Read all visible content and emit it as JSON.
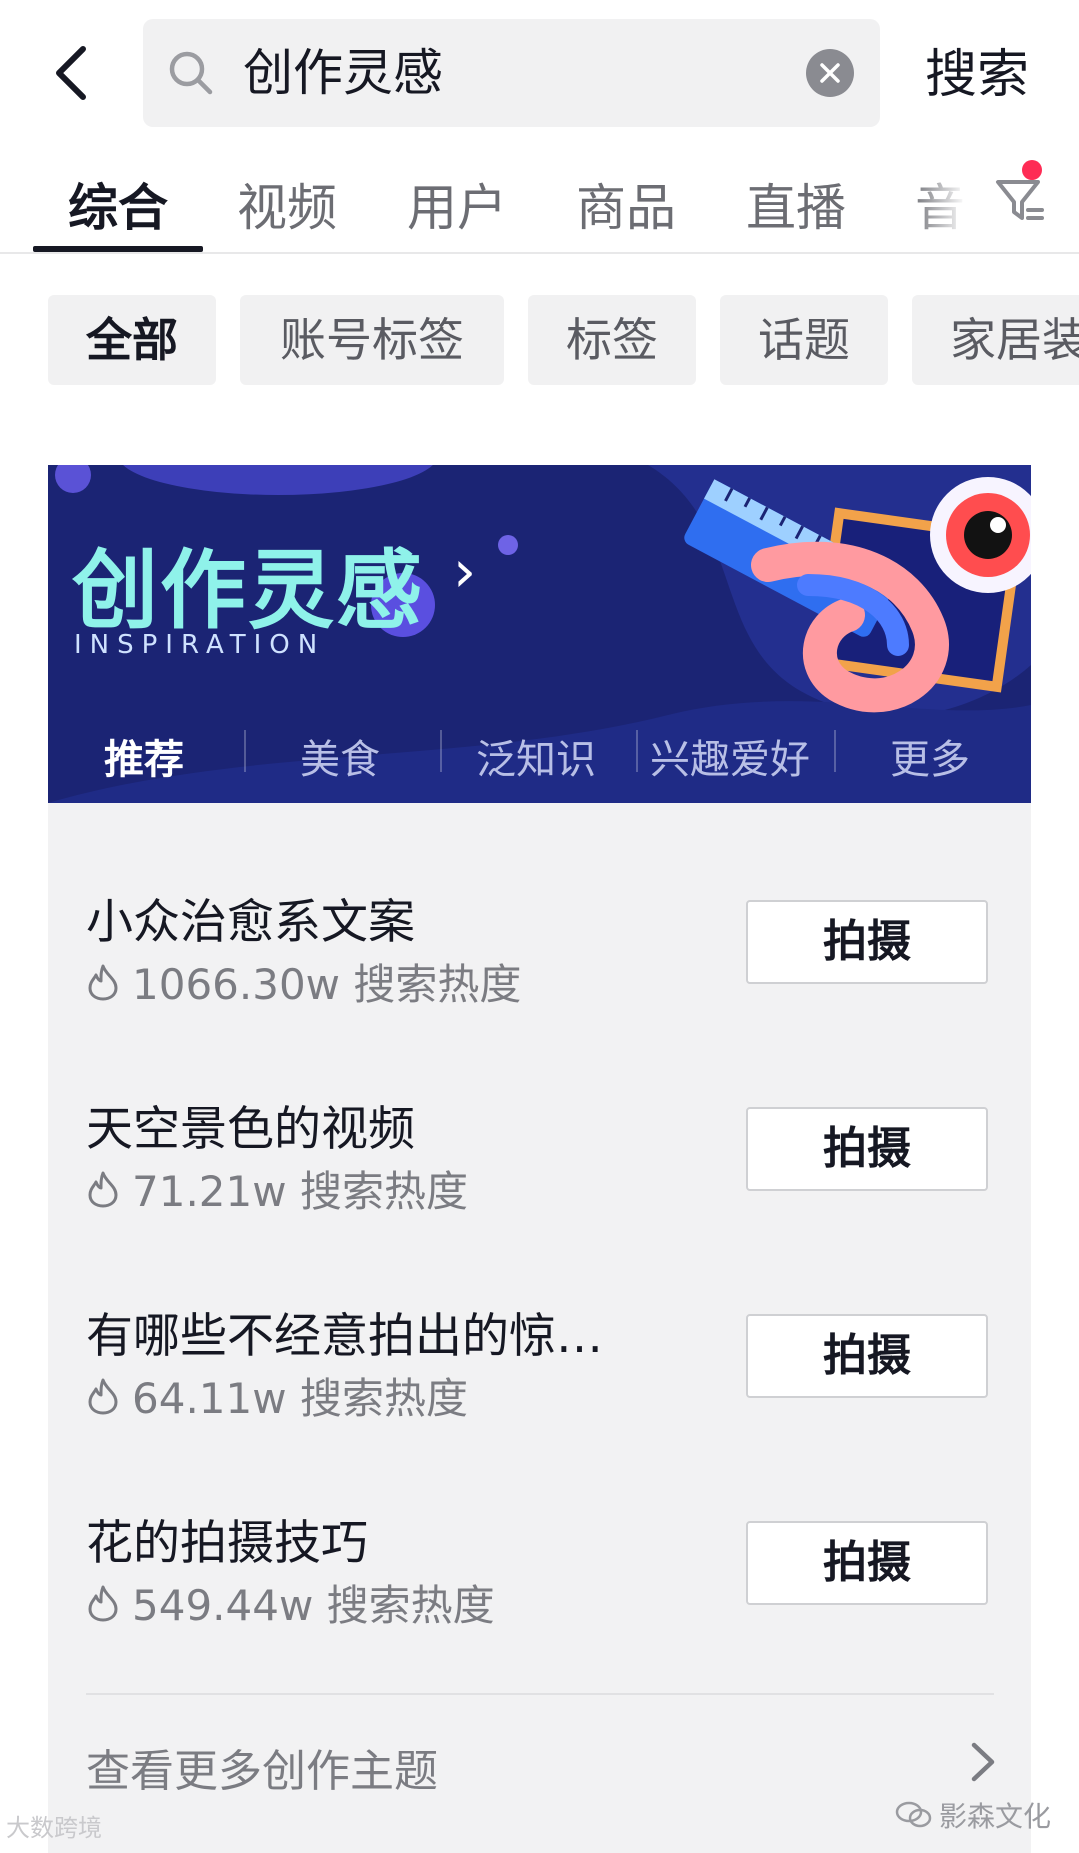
{
  "search": {
    "query": "创作灵感",
    "submit_label": "搜索"
  },
  "tabs": [
    {
      "label": "综合"
    },
    {
      "label": "视频"
    },
    {
      "label": "用户"
    },
    {
      "label": "商品"
    },
    {
      "label": "直播"
    },
    {
      "label": "音"
    }
  ],
  "chips": [
    {
      "label": "全部"
    },
    {
      "label": "账号标签"
    },
    {
      "label": "标签"
    },
    {
      "label": "话题"
    },
    {
      "label": "家居装"
    }
  ],
  "banner": {
    "title": "创作灵感",
    "arrow": "›",
    "subtitle": "INSPIRATION",
    "categories": [
      {
        "label": "推荐"
      },
      {
        "label": "美食"
      },
      {
        "label": "泛知识"
      },
      {
        "label": "兴趣爱好"
      },
      {
        "label": "更多"
      }
    ]
  },
  "topics": [
    {
      "title": "小众治愈系文案",
      "heat": "1066.30w 搜索热度",
      "action": "拍摄"
    },
    {
      "title": "天空景色的视频",
      "heat": "71.21w 搜索热度",
      "action": "拍摄"
    },
    {
      "title": "有哪些不经意拍出的惊…",
      "heat": "64.11w 搜索热度",
      "action": "拍摄"
    },
    {
      "title": "花的拍摄技巧",
      "heat": "549.44w 搜索热度",
      "action": "拍摄"
    }
  ],
  "more_link": "查看更多创作主题",
  "watermarks": {
    "left": "大数跨境",
    "right": "影森文化"
  },
  "colors": {
    "accent_red": "#fe2c55",
    "banner_bg": "#1b2474",
    "banner_title": "#8ff2ea",
    "card_bg": "#f2f2f3"
  }
}
